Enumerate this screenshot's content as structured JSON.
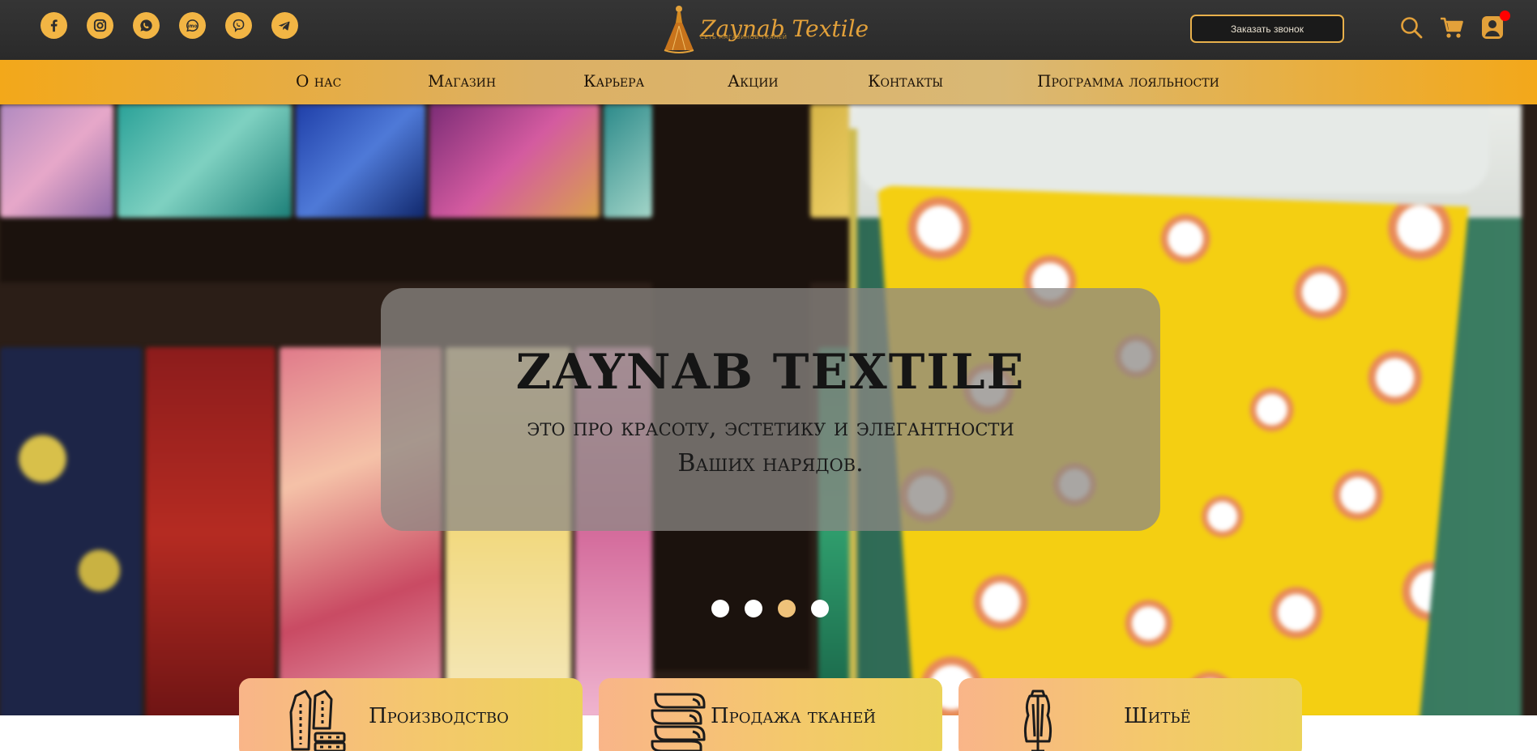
{
  "header": {
    "socials": [
      {
        "icon": "facebook-icon"
      },
      {
        "icon": "instagram-icon"
      },
      {
        "icon": "whatsapp-icon"
      },
      {
        "icon": "imo-icon",
        "text": "imo"
      },
      {
        "icon": "viber-icon"
      },
      {
        "icon": "telegram-icon"
      }
    ],
    "logo_text": "Zaynab Textile",
    "logo_sub": "СЕТЬ МАГАЗИНОВ ТКАНЕЙ",
    "call_button": "Заказать звонок",
    "icons": [
      "search-icon",
      "cart-icon",
      "account-icon"
    ]
  },
  "nav": {
    "items": [
      "О нас",
      "Магазин",
      "Карьера",
      "Акции",
      "Контакты",
      "Программа лояльности"
    ]
  },
  "hero": {
    "title": "ZAYNAB TEXTILE",
    "subtitle_line1": "это про красоту, эстетику и элегантности",
    "subtitle_line2": "Ваших нарядов.",
    "slides_count": 4,
    "active_slide": 3
  },
  "services": [
    {
      "label": "Производство",
      "icon": "garment-pattern-icon"
    },
    {
      "label": "Продажа тканей",
      "icon": "fabric-rolls-icon"
    },
    {
      "label": "Шитьё",
      "icon": "dress-form-icon"
    }
  ],
  "colors": {
    "accent": "#f3a81a",
    "topbar": "#2e2e2e",
    "logo_gold": "#e3a13a",
    "notification": "#ff0000"
  }
}
